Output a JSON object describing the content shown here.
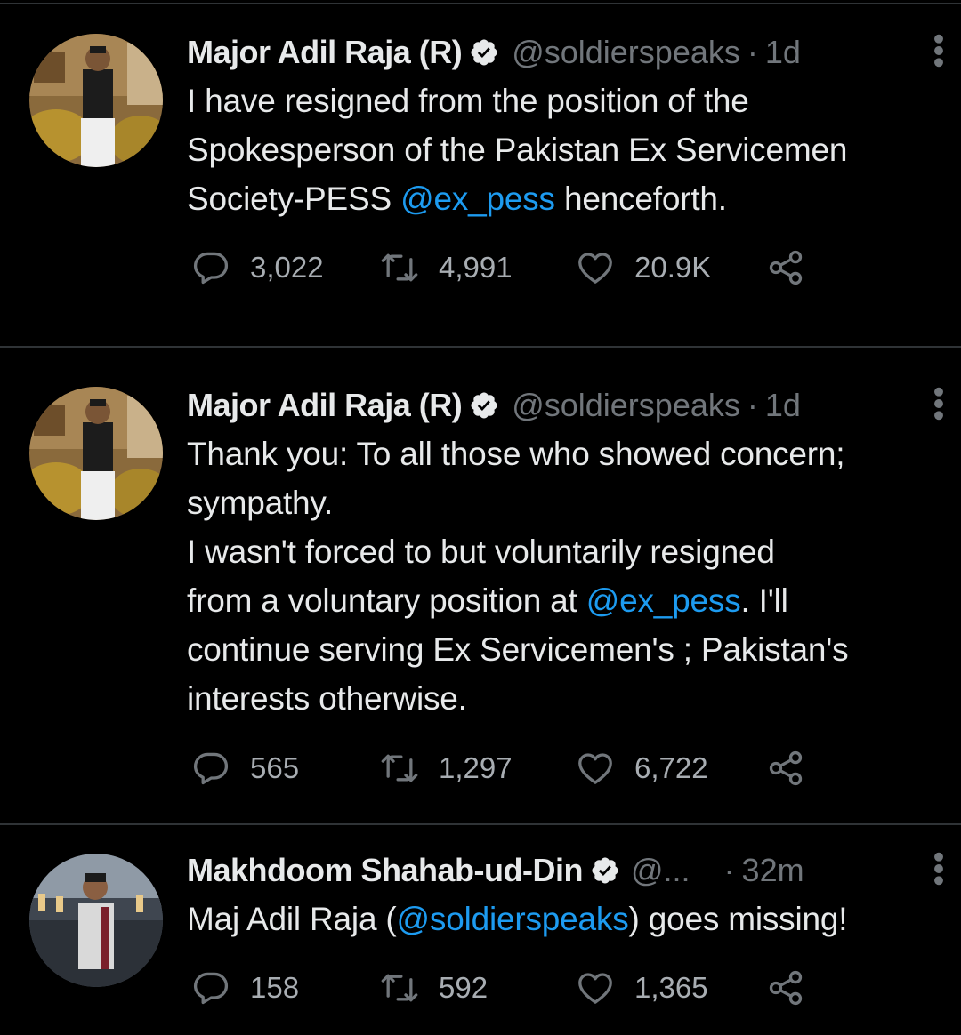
{
  "colors": {
    "background": "#000000",
    "text": "#e7e9ea",
    "secondary": "#71767b",
    "link": "#1d9bf0",
    "divider": "#2f3336"
  },
  "tweets": [
    {
      "name": "Major Adil Raja (R)",
      "verified": true,
      "handle": "@soldierspeaks",
      "dot": "·",
      "time": "1d",
      "text_parts": [
        "I have resigned from the position of the",
        "Spokesperson of the Pakistan Ex Servicemen",
        "Society-PESS",
        "@ex_pess",
        "henceforth."
      ],
      "replies": "3,022",
      "retweets": "4,991",
      "likes": "20.9K",
      "icons": [
        "reply-icon",
        "retweet-icon",
        "like-icon",
        "share-icon",
        "more-icon",
        "verified-icon"
      ]
    },
    {
      "name": "Major Adil Raja (R)",
      "verified": true,
      "handle": "@soldierspeaks",
      "dot": "·",
      "time": "1d",
      "text_parts": [
        "Thank you: To all those who showed concern;",
        "sympathy.",
        "I wasn't forced to but voluntarily resigned",
        "from a voluntary position at",
        "@ex_pess",
        ". I'll",
        "continue serving Ex Servicemen's ; Pakistan's",
        "interests otherwise."
      ],
      "replies": "565",
      "retweets": "1,297",
      "likes": "6,722",
      "icons": [
        "reply-icon",
        "retweet-icon",
        "like-icon",
        "share-icon",
        "more-icon",
        "verified-icon"
      ]
    },
    {
      "name": "Makhdoom Shahab-ud-Din",
      "verified": true,
      "handle": "@...",
      "dot": "·",
      "time": "32m",
      "text_parts": [
        "Maj Adil Raja (",
        "@soldierspeaks",
        ") goes missing!"
      ],
      "replies": "158",
      "retweets": "592",
      "likes": "1,365",
      "icons": [
        "reply-icon",
        "retweet-icon",
        "like-icon",
        "share-icon",
        "more-icon",
        "verified-icon"
      ]
    }
  ]
}
